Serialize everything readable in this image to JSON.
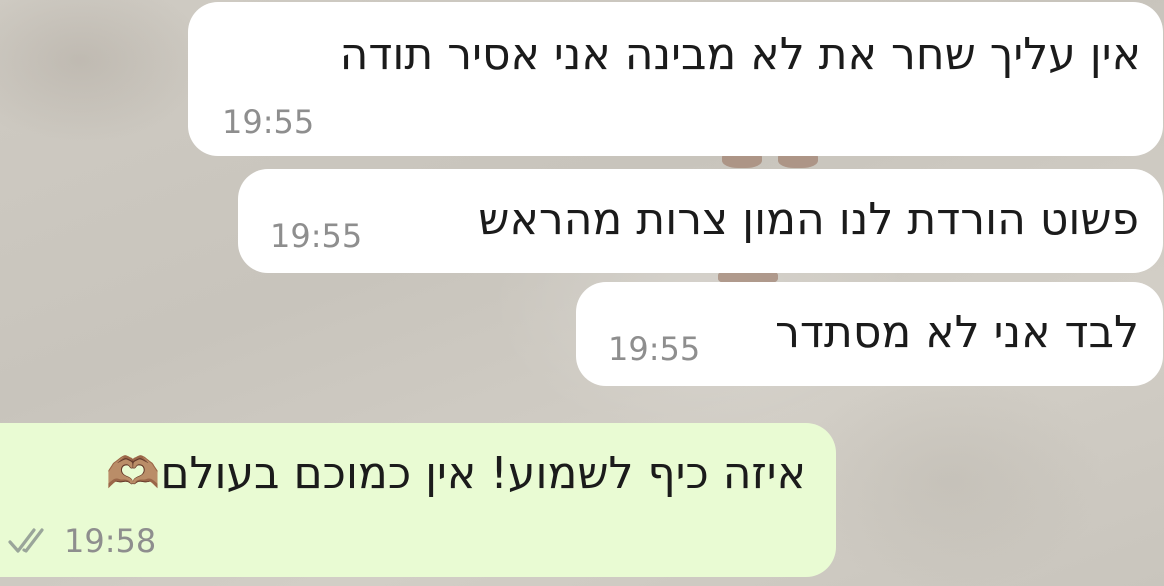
{
  "conversation": {
    "messages": [
      {
        "direction": "incoming",
        "text": "אין עליך שחר את לא מבינה אני אסיר תודה",
        "time": "19:55"
      },
      {
        "direction": "incoming",
        "text": "פשוט הורדת לנו המון צרות מהראש",
        "time": "19:55"
      },
      {
        "direction": "incoming",
        "text": "לבד אני לא מסתדר",
        "time": "19:55"
      },
      {
        "direction": "outgoing",
        "text": "איזה כיף לשמוע! אין כמוכם בעולם🫶🏽",
        "time": "19:58",
        "status": "read-double-check-icon"
      }
    ]
  },
  "colors": {
    "incoming_bubble": "#ffffff",
    "outgoing_bubble": "#e9fbd3",
    "time_text": "#8e8e8e",
    "check_color": "#9aa59a"
  }
}
